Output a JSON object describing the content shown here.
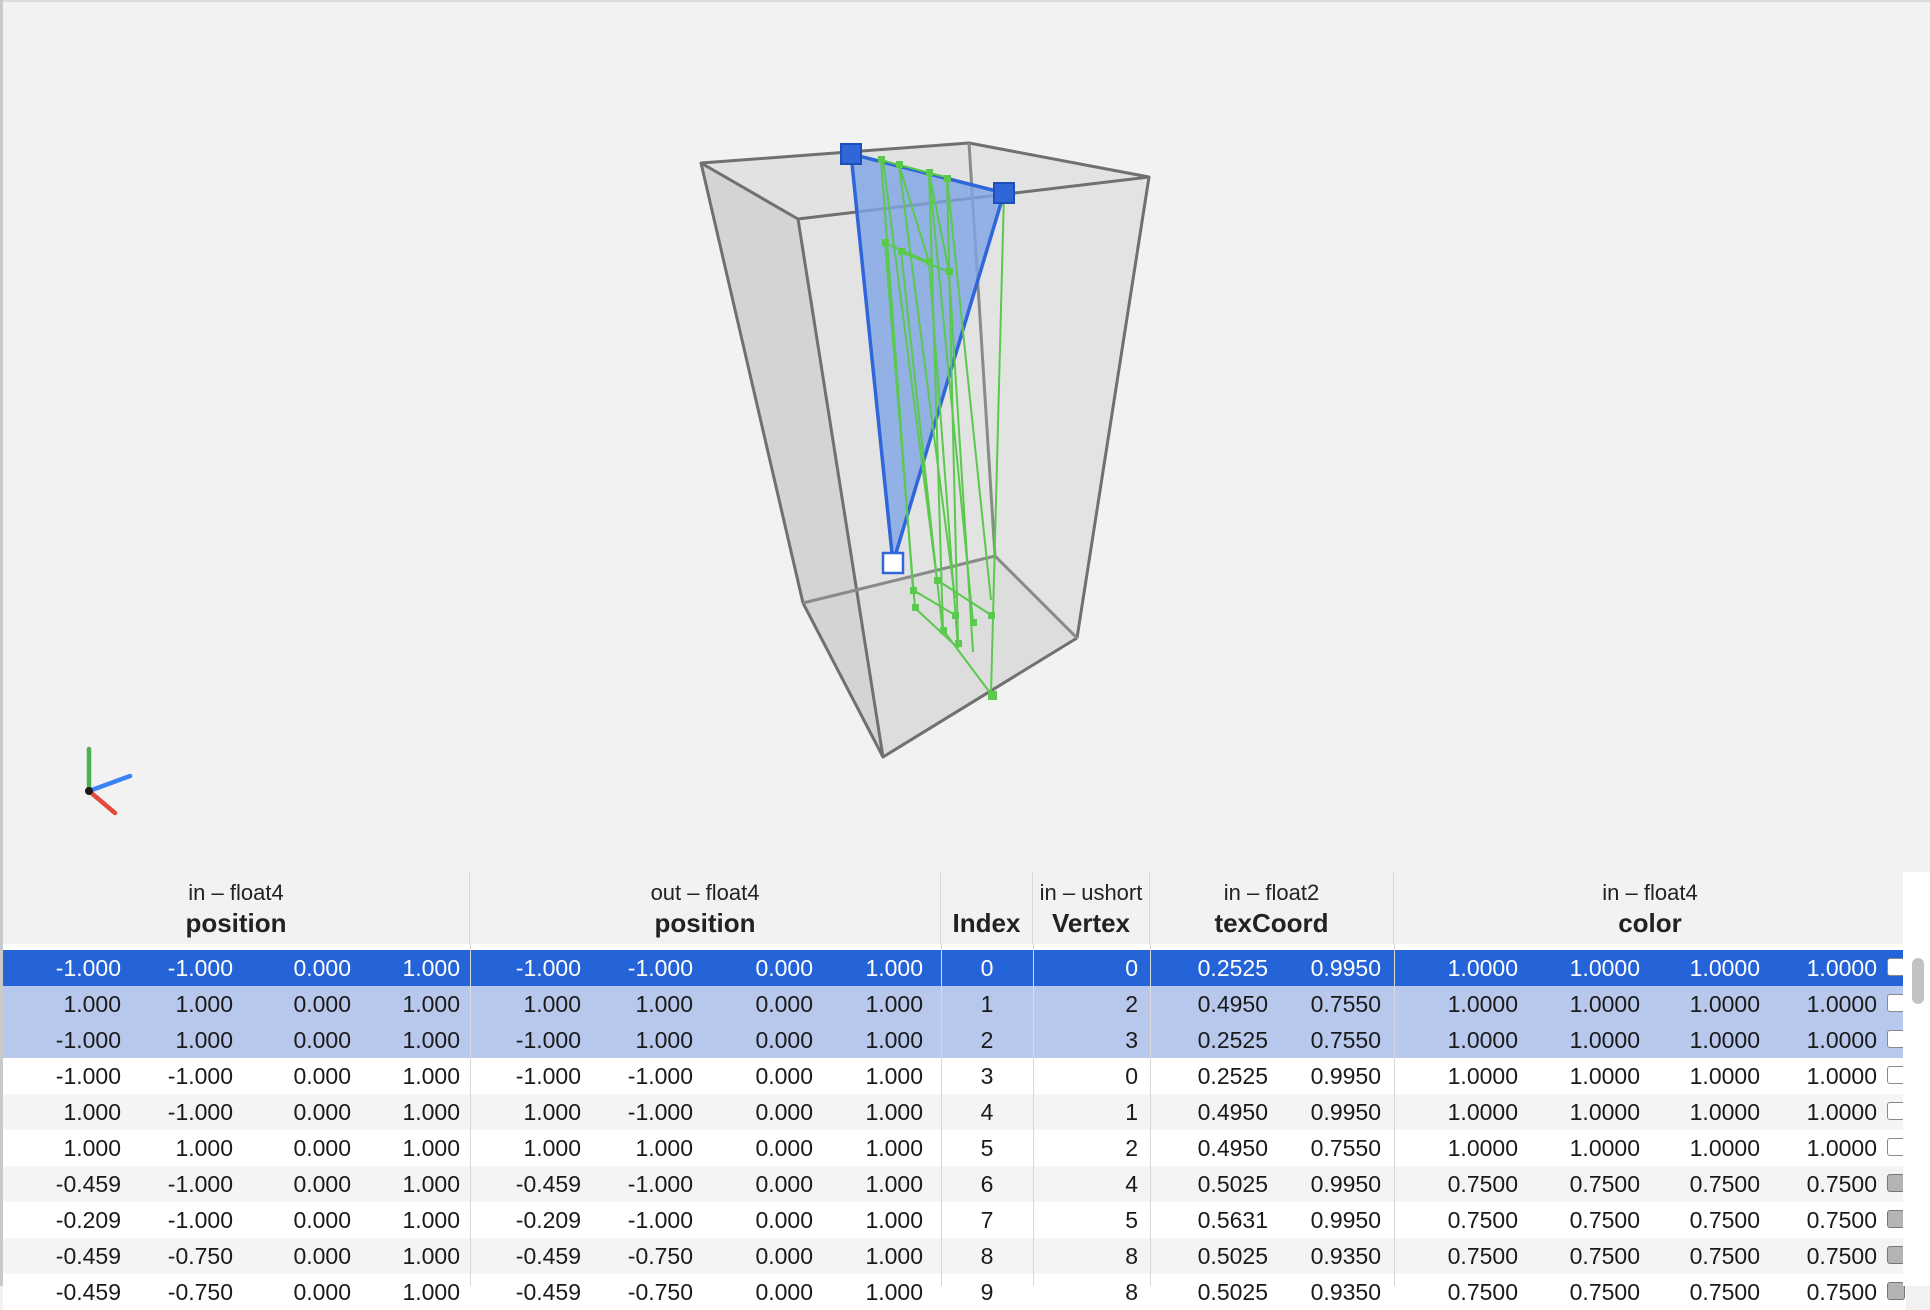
{
  "viewport": {
    "colors": {
      "background": "#f2f2f2",
      "box_edge": "#6e6e6e",
      "box_fill": "#d8d8d8",
      "selected_triangle": "#2f66d9",
      "selected_fill": "#8fb0e6",
      "wire": "#56c94a",
      "axis_x": "#e54b3c",
      "axis_y": "#4caf50",
      "axis_z": "#3b82f6"
    }
  },
  "table": {
    "columns": [
      {
        "sub": "in – float4",
        "main": "position"
      },
      {
        "sub": "out – float4",
        "main": "position"
      },
      {
        "sub": "",
        "main": "Index"
      },
      {
        "sub": "in – ushort",
        "main": "Vertex"
      },
      {
        "sub": "in – float2",
        "main": "texCoord"
      },
      {
        "sub": "in – float4",
        "main": "color"
      }
    ],
    "rows": [
      {
        "inpos": [
          "-1.000",
          "-1.000",
          "0.000",
          "1.000"
        ],
        "outpos": [
          "-1.000",
          "-1.000",
          "0.000",
          "1.000"
        ],
        "index": "0",
        "vertex": "0",
        "tex": [
          "0.2525",
          "0.9950"
        ],
        "color": [
          "1.0000",
          "1.0000",
          "1.0000",
          "1.0000"
        ],
        "state": "primary",
        "swatch": "white"
      },
      {
        "inpos": [
          "1.000",
          "1.000",
          "0.000",
          "1.000"
        ],
        "outpos": [
          "1.000",
          "1.000",
          "0.000",
          "1.000"
        ],
        "index": "1",
        "vertex": "2",
        "tex": [
          "0.4950",
          "0.7550"
        ],
        "color": [
          "1.0000",
          "1.0000",
          "1.0000",
          "1.0000"
        ],
        "state": "secondary",
        "swatch": "white"
      },
      {
        "inpos": [
          "-1.000",
          "1.000",
          "0.000",
          "1.000"
        ],
        "outpos": [
          "-1.000",
          "1.000",
          "0.000",
          "1.000"
        ],
        "index": "2",
        "vertex": "3",
        "tex": [
          "0.2525",
          "0.7550"
        ],
        "color": [
          "1.0000",
          "1.0000",
          "1.0000",
          "1.0000"
        ],
        "state": "secondary",
        "swatch": "white"
      },
      {
        "inpos": [
          "-1.000",
          "-1.000",
          "0.000",
          "1.000"
        ],
        "outpos": [
          "-1.000",
          "-1.000",
          "0.000",
          "1.000"
        ],
        "index": "3",
        "vertex": "0",
        "tex": [
          "0.2525",
          "0.9950"
        ],
        "color": [
          "1.0000",
          "1.0000",
          "1.0000",
          "1.0000"
        ],
        "state": "none",
        "swatch": "white"
      },
      {
        "inpos": [
          "1.000",
          "-1.000",
          "0.000",
          "1.000"
        ],
        "outpos": [
          "1.000",
          "-1.000",
          "0.000",
          "1.000"
        ],
        "index": "4",
        "vertex": "1",
        "tex": [
          "0.4950",
          "0.9950"
        ],
        "color": [
          "1.0000",
          "1.0000",
          "1.0000",
          "1.0000"
        ],
        "state": "none",
        "swatch": "white"
      },
      {
        "inpos": [
          "1.000",
          "1.000",
          "0.000",
          "1.000"
        ],
        "outpos": [
          "1.000",
          "1.000",
          "0.000",
          "1.000"
        ],
        "index": "5",
        "vertex": "2",
        "tex": [
          "0.4950",
          "0.7550"
        ],
        "color": [
          "1.0000",
          "1.0000",
          "1.0000",
          "1.0000"
        ],
        "state": "none",
        "swatch": "white"
      },
      {
        "inpos": [
          "-0.459",
          "-1.000",
          "0.000",
          "1.000"
        ],
        "outpos": [
          "-0.459",
          "-1.000",
          "0.000",
          "1.000"
        ],
        "index": "6",
        "vertex": "4",
        "tex": [
          "0.5025",
          "0.9950"
        ],
        "color": [
          "0.7500",
          "0.7500",
          "0.7500",
          "0.7500"
        ],
        "state": "none",
        "swatch": "gray"
      },
      {
        "inpos": [
          "-0.209",
          "-1.000",
          "0.000",
          "1.000"
        ],
        "outpos": [
          "-0.209",
          "-1.000",
          "0.000",
          "1.000"
        ],
        "index": "7",
        "vertex": "5",
        "tex": [
          "0.5631",
          "0.9950"
        ],
        "color": [
          "0.7500",
          "0.7500",
          "0.7500",
          "0.7500"
        ],
        "state": "none",
        "swatch": "gray"
      },
      {
        "inpos": [
          "-0.459",
          "-0.750",
          "0.000",
          "1.000"
        ],
        "outpos": [
          "-0.459",
          "-0.750",
          "0.000",
          "1.000"
        ],
        "index": "8",
        "vertex": "8",
        "tex": [
          "0.5025",
          "0.9350"
        ],
        "color": [
          "0.7500",
          "0.7500",
          "0.7500",
          "0.7500"
        ],
        "state": "none",
        "swatch": "gray"
      },
      {
        "inpos": [
          "-0.459",
          "-0.750",
          "0.000",
          "1.000"
        ],
        "outpos": [
          "-0.459",
          "-0.750",
          "0.000",
          "1.000"
        ],
        "index": "9",
        "vertex": "8",
        "tex": [
          "0.5025",
          "0.9350"
        ],
        "color": [
          "0.7500",
          "0.7500",
          "0.7500",
          "0.7500"
        ],
        "state": "none",
        "swatch": "gray"
      }
    ],
    "row_colors": {
      "primary": "#2563d9",
      "secondary": "#b7c8ec",
      "stripe": "#f4f4f4",
      "plain": "#ffffff"
    }
  }
}
